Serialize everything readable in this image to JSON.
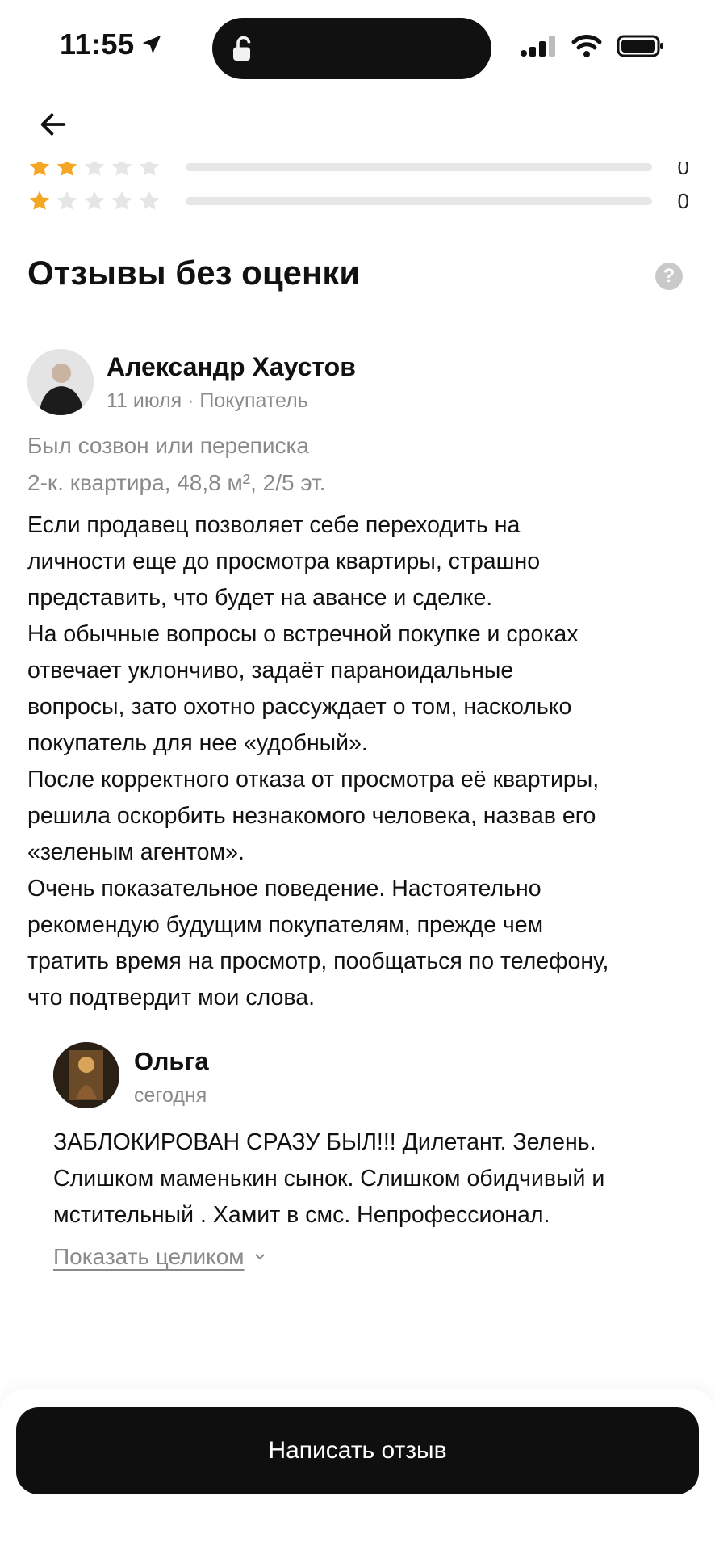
{
  "status_bar": {
    "time": "11:55"
  },
  "ratings": [
    {
      "stars_filled": 2,
      "count": "0"
    },
    {
      "stars_filled": 1,
      "count": "0"
    }
  ],
  "section": {
    "title": "Отзывы без оценки",
    "help_icon": "?"
  },
  "review": {
    "author": "Александр Хаустов",
    "meta": "11 июля · Покупатель",
    "deal_type": "Был созвон или переписка",
    "property": "2-к. квартира, 48,8 м², 2/5 эт.",
    "text": "Если продавец позволяет себе переходить на\nличности еще до просмотра квартиры, страшно\nпредставить, что будет на авансе и сделке.\nНа обычные вопросы о встречной покупке и сроках\nотвечает уклончиво, задаёт параноидальные\nвопросы, зато охотно рассуждает о том, насколько\nпокупатель для нее «удобный».\nПосле корректного отказа от просмотра её квартиры,\nрешила оскорбить незнакомого человека, назвав его\n«зеленым агентом».\nОчень показательное поведение. Настоятельно\nрекомендую будущим покупателям, прежде чем\nтратить время на просмотр, пообщаться по телефону,\nчто подтвердит мои слова."
  },
  "reply": {
    "author": "Ольга",
    "meta": "сегодня",
    "text": "ЗАБЛОКИРОВАН СРАЗУ БЫЛ!!!  Дилетант. Зелень.\nСлишком маменькин сынок. Слишком обидчивый и\nмстительный . Хамит в смс.  Непрофессионал.",
    "show_more": "Показать целиком"
  },
  "cta": {
    "label": "Написать отзыв"
  },
  "colors": {
    "star": "#F5A623",
    "star_empty": "#E6E6E6",
    "accent_dark": "#0F0F0F"
  }
}
